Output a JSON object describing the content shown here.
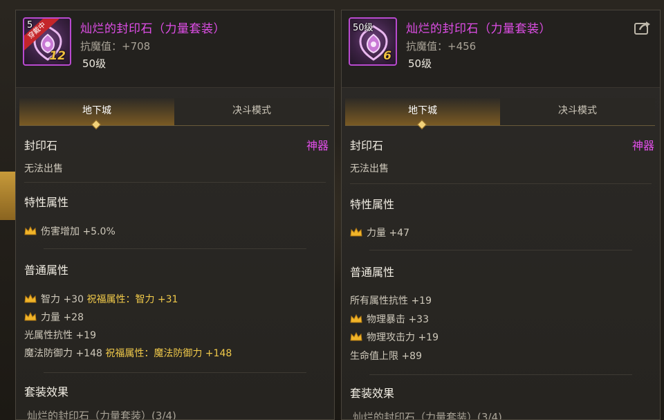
{
  "left": {
    "item_name": "灿烂的封印石（力量套装）",
    "resist": "抗魔值：+708",
    "level": "50级",
    "icon_level": "5",
    "icon_count": "12",
    "equipped_badge": "穿戴中",
    "tab_dungeon": "地下城",
    "tab_pvp": "决斗模式",
    "type": "封印石",
    "grade": "神器",
    "sell": "无法出售",
    "trait_title": "特性属性",
    "trait_attr": "伤害增加 +5.0%",
    "common_title": "普通属性",
    "attr1": "智力 +30",
    "attr1_bless": "祝福属性：智力 +31",
    "attr2": "力量 +28",
    "attr3": "光属性抗性 +19",
    "attr4": "魔法防御力 +148",
    "attr4_bless": "祝福属性：魔法防御力 +148",
    "set_title": "套装效果",
    "set_name_cut": "灿烂的封印石（力量套装）(3/4)"
  },
  "right": {
    "item_name": "灿烂的封印石（力量套装）",
    "resist": "抗魔值：+456",
    "level": "50级",
    "icon_level": "50级",
    "icon_count": "6",
    "tab_dungeon": "地下城",
    "tab_pvp": "决斗模式",
    "type": "封印石",
    "grade": "神器",
    "sell": "无法出售",
    "trait_title": "特性属性",
    "trait_attr": "力量 +47",
    "common_title": "普通属性",
    "attr1": "所有属性抗性 +19",
    "attr2": "物理暴击 +33",
    "attr3": "物理攻击力 +19",
    "attr4": "生命值上限 +89",
    "set_title": "套装效果",
    "set_name_cut": "灿烂的封印石（力量套装）(3/4)"
  },
  "colors": {
    "epic_name": "#e04ee8",
    "bless": "#f0c94a",
    "crown": "#f0b429",
    "tab_active": "#7a5a24"
  },
  "icons": {
    "item": "seal-stone-icon",
    "crown": "crown-icon",
    "share": "share-icon"
  }
}
